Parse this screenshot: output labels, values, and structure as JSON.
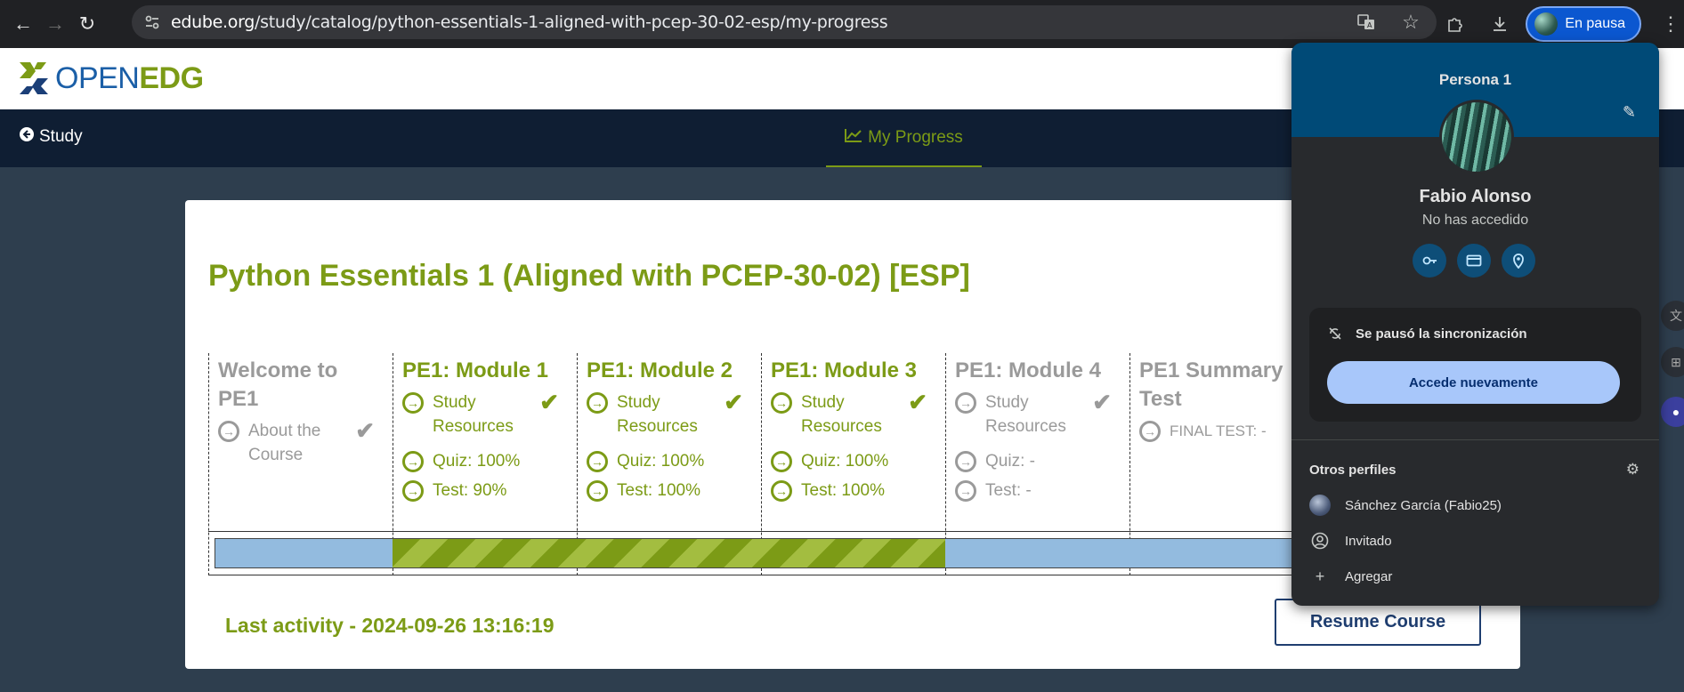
{
  "browser": {
    "url_host": "edube.org",
    "url_path": "/study/catalog/python-essentials-1-aligned-with-pcep-30-02-esp/my-progress",
    "profile_button_label": "En pausa"
  },
  "site": {
    "logo_open": "OPEN",
    "logo_edg": "EDG",
    "nav_study": "Study",
    "nav_progress": "My Progress"
  },
  "course": {
    "title": "Python Essentials 1 (Aligned with PCEP-30-02) [ESP]",
    "modules": [
      {
        "title": "Welcome to PE1",
        "items": [
          "About the Course"
        ],
        "checked": true
      },
      {
        "title": "PE1: Module 1",
        "items": [
          "Study Resources",
          "Quiz: 100%",
          "Test: 90%"
        ],
        "checked": true
      },
      {
        "title": "PE1: Module 2",
        "items": [
          "Study Resources",
          "Quiz: 100%",
          "Test: 100%"
        ],
        "checked": true
      },
      {
        "title": "PE1: Module 3",
        "items": [
          "Study Resources",
          "Quiz: 100%",
          "Test: 100%"
        ],
        "checked": true
      },
      {
        "title": "PE1: Module 4",
        "items": [
          "Study Resources",
          "Quiz: -",
          "Test: -"
        ],
        "checked": true
      },
      {
        "title": "PE1 Summary Test",
        "items": [
          "FINAL TEST: -"
        ],
        "checked": false
      }
    ],
    "last_activity": "Last activity - 2024-09-26 13:16:19",
    "resume_label": "Resume Course"
  },
  "profile_panel": {
    "profile_name": "Persona 1",
    "full_name": "Fabio Alonso",
    "status": "No has accedido",
    "sync_message": "Se pausó la sincronización",
    "relogin_label": "Accede nuevamente",
    "other_profiles_title": "Otros perfiles",
    "other_profiles": [
      "Sánchez García (Fabio25)",
      "Invitado",
      "Agregar"
    ]
  },
  "colors": {
    "brand_green": "#7c9b16",
    "brand_blue": "#1b5fa7",
    "nav_dark": "#0f1e33",
    "chrome_accent": "#0b57d0"
  }
}
